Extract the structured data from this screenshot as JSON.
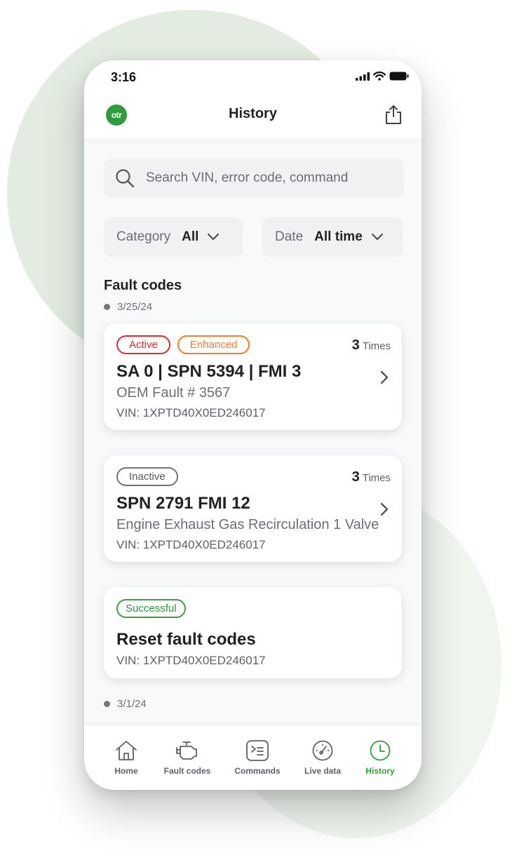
{
  "status_bar": {
    "time": "3:16"
  },
  "header": {
    "logo_text": "otr",
    "title": "History"
  },
  "search": {
    "placeholder": "Search VIN, error code, command"
  },
  "filters": {
    "category": {
      "label": "Category",
      "value": "All"
    },
    "date": {
      "label": "Date",
      "value": "All time"
    }
  },
  "section_title": "Fault codes",
  "groups": [
    {
      "date": "3/25/24"
    },
    {
      "date": "3/1/24"
    }
  ],
  "cards": [
    {
      "badges": [
        "Active",
        "Enhanced"
      ],
      "times_count": "3",
      "times_label": "Times",
      "title": "SA 0 | SPN 5394 | FMI 3",
      "subtitle": "OEM Fault # 3567",
      "vin": "VIN: 1XPTD40X0ED246017"
    },
    {
      "badges": [
        "Inactive"
      ],
      "times_count": "3",
      "times_label": "Times",
      "title": "SPN 2791 FMI 12",
      "subtitle": "Engine Exhaust Gas Recirculation 1 Valve",
      "vin": "VIN: 1XPTD40X0ED246017"
    },
    {
      "badges": [
        "Successful"
      ],
      "title": "Reset fault codes",
      "vin": "VIN: 1XPTD40X0ED246017"
    }
  ],
  "nav": [
    {
      "label": "Home",
      "icon": "home-icon"
    },
    {
      "label": "Fault codes",
      "icon": "engine-icon"
    },
    {
      "label": "Commands",
      "icon": "terminal-icon"
    },
    {
      "label": "Live data",
      "icon": "gauge-icon"
    },
    {
      "label": "History",
      "icon": "clock-icon",
      "active": true
    }
  ],
  "colors": {
    "brand": "#2e9c3c",
    "active": "#d92a2a",
    "enhanced": "#ef7a27",
    "success": "#35a043"
  }
}
